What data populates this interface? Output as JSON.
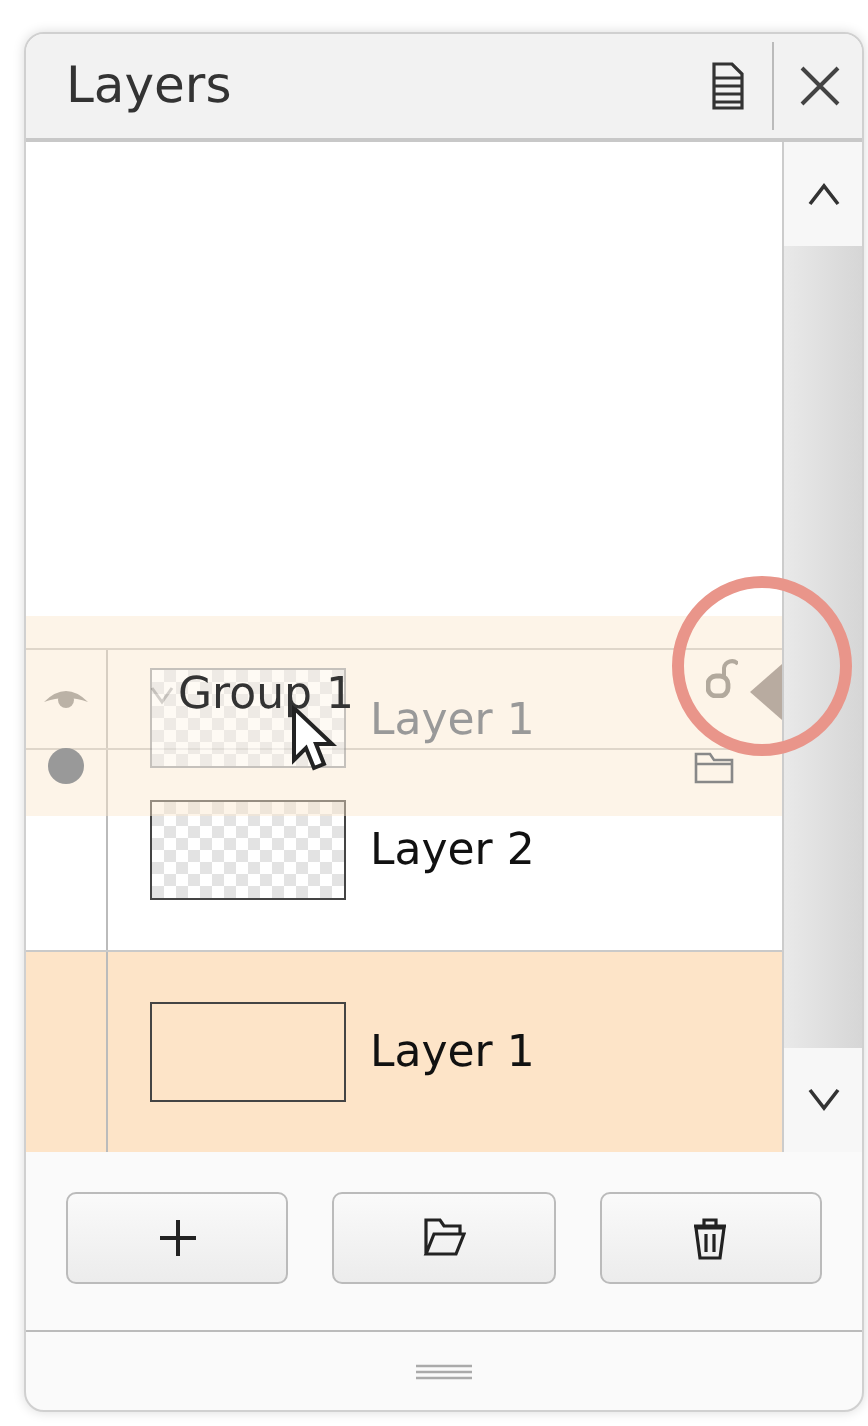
{
  "panel": {
    "title": "Layers"
  },
  "layers": [
    {
      "name": "Group 1",
      "kind": "group",
      "expanded": true,
      "visible": true,
      "locked": false,
      "selected": false
    },
    {
      "name": "Layer 2",
      "kind": "layer",
      "selected": false
    },
    {
      "name": "Layer 1",
      "kind": "layer",
      "selected": true
    }
  ],
  "drag_ghost": {
    "name": "Layer 1"
  },
  "buttons": [
    {
      "kind": "add"
    },
    {
      "kind": "folder"
    },
    {
      "kind": "delete"
    }
  ]
}
